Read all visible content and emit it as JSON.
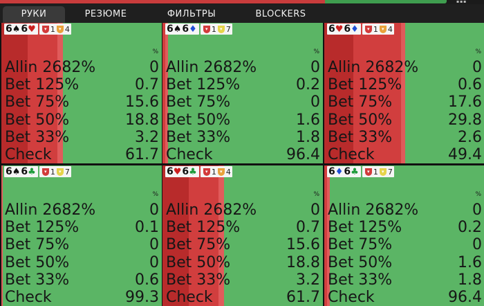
{
  "tabs": [
    {
      "label": "РУКИ",
      "active": true
    },
    {
      "label": "РЕЗЮМЕ",
      "active": false
    },
    {
      "label": "ФИЛЬТРЫ",
      "active": false
    },
    {
      "label": "BLOCKERS",
      "active": false
    }
  ],
  "colors": {
    "background": "#5bb565",
    "bet_large": "#b82b2b",
    "bet_mid": "#d13e3e",
    "bet_small": "#e05b5b",
    "check": "#5bb565",
    "spade_club": "#111111",
    "heart": "#cc1f1f",
    "diamond": "#1f4fd6",
    "shield_red": "#d23a3a",
    "shield_orange": "#e9a23b",
    "shield_yellow": "#e6d44a"
  },
  "percent_symbol": "%",
  "hands": [
    {
      "cards": [
        {
          "rank": "6",
          "suit": "♠",
          "color": "#111111"
        },
        {
          "rank": "6",
          "suit": "♥",
          "color": "#cc1f1f"
        }
      ],
      "blockers": [
        {
          "num": "1",
          "shield": "#d23a3a"
        },
        {
          "num": "4",
          "shield": "#e9a23b"
        }
      ],
      "rows": [
        {
          "label": "Allin 2682%",
          "value": "0"
        },
        {
          "label": "Bet 125%",
          "value": "0.7"
        },
        {
          "label": "Bet 75%",
          "value": "15.6"
        },
        {
          "label": "Bet 50%",
          "value": "18.8"
        },
        {
          "label": "Bet 33%",
          "value": "3.2"
        },
        {
          "label": "Check",
          "value": "61.7"
        }
      ]
    },
    {
      "cards": [
        {
          "rank": "6",
          "suit": "♠",
          "color": "#111111"
        },
        {
          "rank": "6",
          "suit": "♦",
          "color": "#1f4fd6"
        }
      ],
      "blockers": [
        {
          "num": "1",
          "shield": "#d23a3a"
        },
        {
          "num": "7",
          "shield": "#e6d44a"
        }
      ],
      "rows": [
        {
          "label": "Allin 2682%",
          "value": "0"
        },
        {
          "label": "Bet 125%",
          "value": "0.2"
        },
        {
          "label": "Bet 75%",
          "value": "0"
        },
        {
          "label": "Bet 50%",
          "value": "1.6"
        },
        {
          "label": "Bet 33%",
          "value": "1.8"
        },
        {
          "label": "Check",
          "value": "96.4"
        }
      ]
    },
    {
      "cards": [
        {
          "rank": "6",
          "suit": "♥",
          "color": "#cc1f1f"
        },
        {
          "rank": "6",
          "suit": "♦",
          "color": "#1f4fd6"
        }
      ],
      "blockers": [
        {
          "num": "1",
          "shield": "#d23a3a"
        },
        {
          "num": "4",
          "shield": "#e9a23b"
        }
      ],
      "rows": [
        {
          "label": "Allin 2682%",
          "value": "0"
        },
        {
          "label": "Bet 125%",
          "value": "0.6"
        },
        {
          "label": "Bet 75%",
          "value": "17.6"
        },
        {
          "label": "Bet 50%",
          "value": "29.8"
        },
        {
          "label": "Bet 33%",
          "value": "2.6"
        },
        {
          "label": "Check",
          "value": "49.4"
        }
      ]
    },
    {
      "cards": [
        {
          "rank": "6",
          "suit": "♠",
          "color": "#111111"
        },
        {
          "rank": "6",
          "suit": "♣",
          "color": "#1e9b3a"
        }
      ],
      "blockers": [
        {
          "num": "1",
          "shield": "#d23a3a"
        },
        {
          "num": "7",
          "shield": "#e6d44a"
        }
      ],
      "rows": [
        {
          "label": "Allin 2682%",
          "value": "0"
        },
        {
          "label": "Bet 125%",
          "value": "0.1"
        },
        {
          "label": "Bet 75%",
          "value": "0"
        },
        {
          "label": "Bet 50%",
          "value": "0"
        },
        {
          "label": "Bet 33%",
          "value": "0.6"
        },
        {
          "label": "Check",
          "value": "99.3"
        }
      ]
    },
    {
      "cards": [
        {
          "rank": "6",
          "suit": "♥",
          "color": "#cc1f1f"
        },
        {
          "rank": "6",
          "suit": "♣",
          "color": "#1e9b3a"
        }
      ],
      "blockers": [
        {
          "num": "1",
          "shield": "#d23a3a"
        },
        {
          "num": "4",
          "shield": "#e9a23b"
        }
      ],
      "rows": [
        {
          "label": "Allin 2682%",
          "value": "0"
        },
        {
          "label": "Bet 125%",
          "value": "0.7"
        },
        {
          "label": "Bet 75%",
          "value": "15.6"
        },
        {
          "label": "Bet 50%",
          "value": "18.8"
        },
        {
          "label": "Bet 33%",
          "value": "3.2"
        },
        {
          "label": "Check",
          "value": "61.7"
        }
      ]
    },
    {
      "cards": [
        {
          "rank": "6",
          "suit": "♦",
          "color": "#1f4fd6"
        },
        {
          "rank": "6",
          "suit": "♣",
          "color": "#1e9b3a"
        }
      ],
      "blockers": [
        {
          "num": "1",
          "shield": "#d23a3a"
        },
        {
          "num": "7",
          "shield": "#e6d44a"
        }
      ],
      "rows": [
        {
          "label": "Allin 2682%",
          "value": "0"
        },
        {
          "label": "Bet 125%",
          "value": "0.2"
        },
        {
          "label": "Bet 75%",
          "value": "0"
        },
        {
          "label": "Bet 50%",
          "value": "1.6"
        },
        {
          "label": "Bet 33%",
          "value": "1.8"
        },
        {
          "label": "Check",
          "value": "96.4"
        }
      ]
    }
  ]
}
